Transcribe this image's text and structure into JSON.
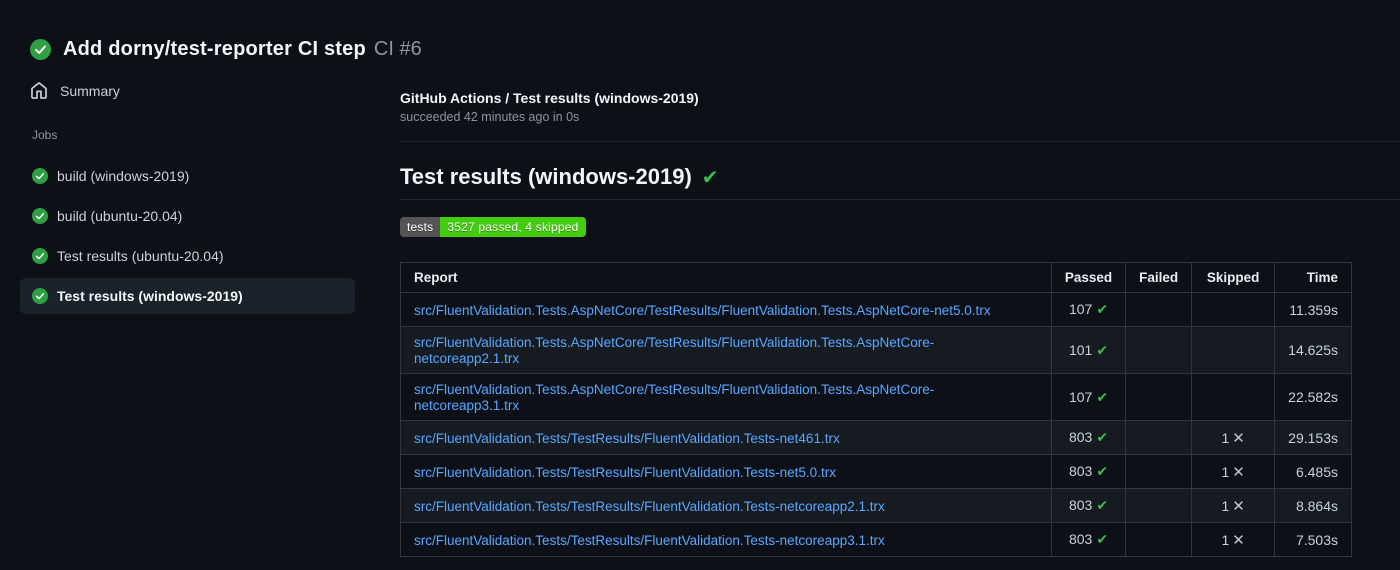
{
  "header": {
    "title": "Add dorny/test-reporter CI step",
    "run_number": "CI #6"
  },
  "sidebar": {
    "summary_label": "Summary",
    "jobs_label": "Jobs",
    "jobs": [
      {
        "label": "build (windows-2019)",
        "selected": false
      },
      {
        "label": "build (ubuntu-20.04)",
        "selected": false
      },
      {
        "label": "Test results (ubuntu-20.04)",
        "selected": false
      },
      {
        "label": "Test results (windows-2019)",
        "selected": true
      }
    ]
  },
  "main": {
    "run_title": "GitHub Actions / Test results (windows-2019)",
    "run_status": "succeeded 42 minutes ago in 0s",
    "section_title": "Test results (windows-2019)",
    "badge": {
      "label": "tests",
      "value": "3527 passed, 4 skipped",
      "label_bg": "#555555",
      "value_bg": "#44cc11"
    },
    "table": {
      "columns": [
        "Report",
        "Passed",
        "Failed",
        "Skipped",
        "Time"
      ],
      "rows": [
        {
          "report": "src/FluentValidation.Tests.AspNetCore/TestResults/FluentValidation.Tests.AspNetCore-net5.0.trx",
          "passed": "107",
          "failed": "",
          "skipped": "",
          "time": "11.359s"
        },
        {
          "report": "src/FluentValidation.Tests.AspNetCore/TestResults/FluentValidation.Tests.AspNetCore-netcoreapp2.1.trx",
          "passed": "101",
          "failed": "",
          "skipped": "",
          "time": "14.625s"
        },
        {
          "report": "src/FluentValidation.Tests.AspNetCore/TestResults/FluentValidation.Tests.AspNetCore-netcoreapp3.1.trx",
          "passed": "107",
          "failed": "",
          "skipped": "",
          "time": "22.582s"
        },
        {
          "report": "src/FluentValidation.Tests/TestResults/FluentValidation.Tests-net461.trx",
          "passed": "803",
          "failed": "",
          "skipped": "1",
          "time": "29.153s"
        },
        {
          "report": "src/FluentValidation.Tests/TestResults/FluentValidation.Tests-net5.0.trx",
          "passed": "803",
          "failed": "",
          "skipped": "1",
          "time": "6.485s"
        },
        {
          "report": "src/FluentValidation.Tests/TestResults/FluentValidation.Tests-netcoreapp2.1.trx",
          "passed": "803",
          "failed": "",
          "skipped": "1",
          "time": "8.864s"
        },
        {
          "report": "src/FluentValidation.Tests/TestResults/FluentValidation.Tests-netcoreapp3.1.trx",
          "passed": "803",
          "failed": "",
          "skipped": "1",
          "time": "7.503s"
        }
      ]
    }
  },
  "icons": {
    "pass_check": "✔",
    "skip_x": "✕",
    "heading_check": "✔"
  },
  "colors": {
    "success_green": "#2ea043",
    "check_green": "#3fb950",
    "link_blue": "#58a6ff",
    "badge_label_bg": "#555555",
    "badge_value_bg": "#44cc11"
  }
}
